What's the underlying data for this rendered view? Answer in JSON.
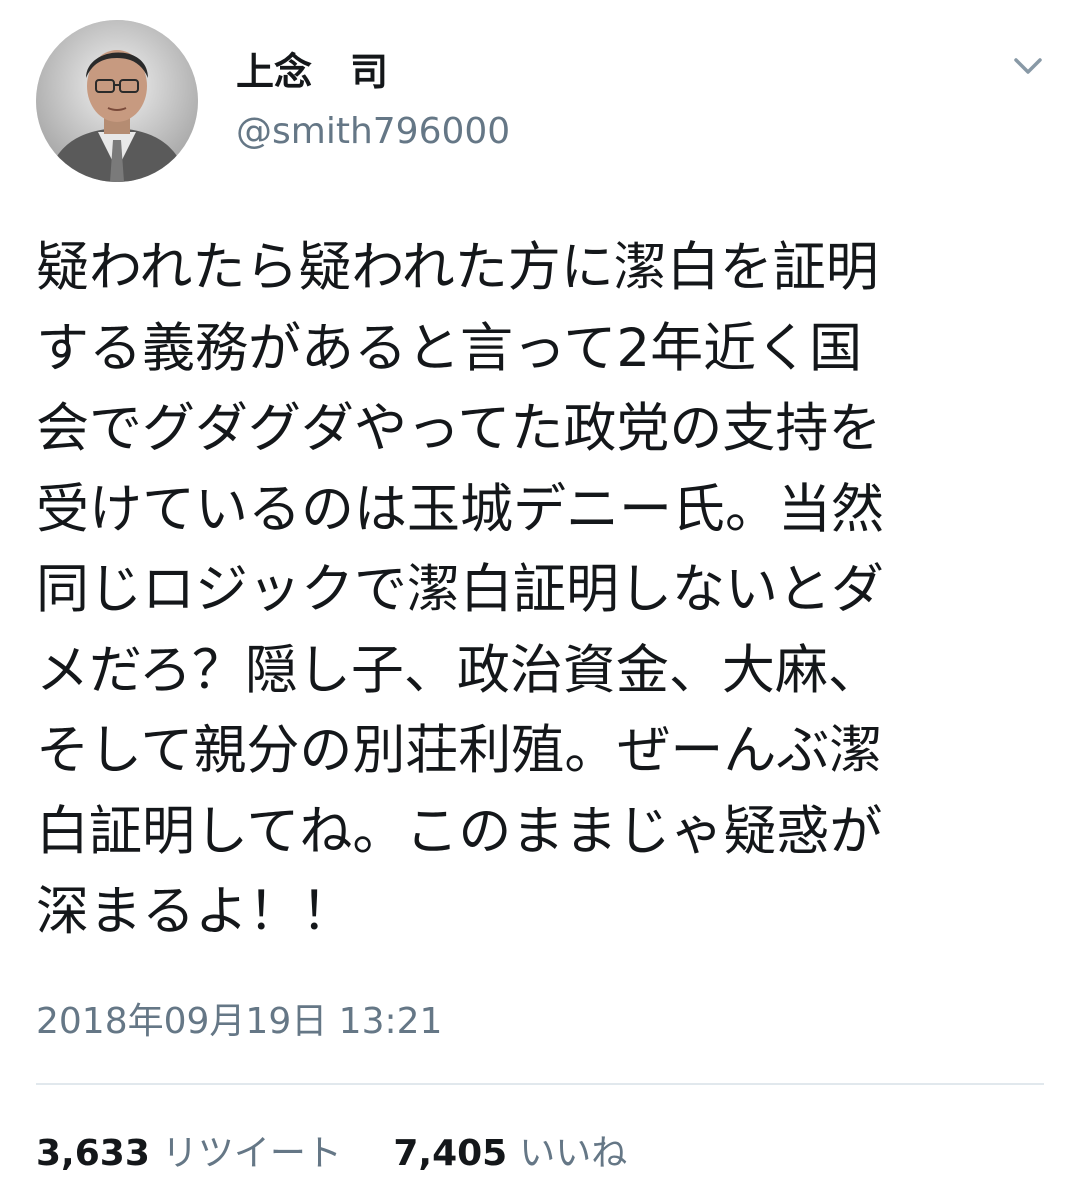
{
  "user": {
    "display_name": "上念　司",
    "handle": "@smith796000",
    "avatar_icon": "user-avatar-photo"
  },
  "menu": {
    "icon": "chevron-down-icon"
  },
  "tweet": {
    "lines": [
      "疑われたら疑われた方に潔白を証明",
      "する義務があると言って2年近く国",
      "会でグダグダやってた政党の支持を",
      "受けているのは玉城デニー氏。当然",
      "同じロジックで潔白証明しないとダ",
      "メだろ？隠し子、政治資金、大麻、",
      "そして親分の別荘利殖。ぜーんぶ潔",
      "白証明してね。このままじゃ疑惑が",
      "深まるよ！！"
    ],
    "timestamp": "2018年09月19日 13:21"
  },
  "stats": {
    "retweets_count": "3,633",
    "retweets_label": "リツイート",
    "likes_count": "7,405",
    "likes_label": "いいね"
  },
  "colors": {
    "text": "#14171a",
    "secondary": "#657786",
    "divider": "#e1e8ed"
  }
}
